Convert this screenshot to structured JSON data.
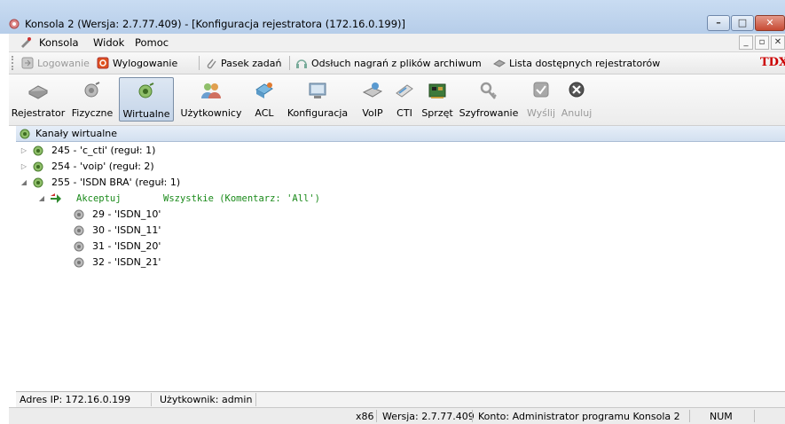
{
  "window": {
    "title": "Konsola 2 (Wersja:  2.7.77.409) - [Konfiguracja rejestratora (172.16.0.199)]",
    "minimize": "–",
    "maximize": "□",
    "close": "✕"
  },
  "menu": {
    "items": [
      "Konsola",
      "Widok",
      "Pomoc"
    ],
    "mdi_min": "_",
    "mdi_restore": "▫",
    "mdi_close": "✕"
  },
  "toolbar_top": {
    "login": "Logowanie",
    "logout": "Wylogowanie",
    "taskbar": "Pasek zadań",
    "listen": "Odsłuch nagrań z plików archiwum",
    "recorders": "Lista dostępnych rejestratorów",
    "brand": "TDX"
  },
  "toolbar_main": {
    "buttons": [
      {
        "label": "Rejestrator",
        "icon": "recorder-icon",
        "active": false,
        "enabled": true
      },
      {
        "label": "Fizyczne",
        "icon": "physical-channels-icon",
        "active": false,
        "enabled": true
      },
      {
        "label": "Wirtualne",
        "icon": "virtual-channels-icon",
        "active": true,
        "enabled": true
      },
      {
        "label": "Użytkownicy",
        "icon": "users-icon",
        "active": false,
        "enabled": true
      },
      {
        "label": "ACL",
        "icon": "acl-icon",
        "active": false,
        "enabled": true
      },
      {
        "label": "Konfiguracja",
        "icon": "configuration-icon",
        "active": false,
        "enabled": true
      },
      {
        "label": "VoIP",
        "icon": "voip-icon",
        "active": false,
        "enabled": true
      },
      {
        "label": "CTI",
        "icon": "cti-icon",
        "active": false,
        "enabled": true
      },
      {
        "label": "Sprzęt",
        "icon": "hardware-icon",
        "active": false,
        "enabled": true
      },
      {
        "label": "Szyfrowanie",
        "icon": "encryption-icon",
        "active": false,
        "enabled": true
      },
      {
        "label": "Wyślij",
        "icon": "send-icon",
        "active": false,
        "enabled": false
      },
      {
        "label": "Anuluj",
        "icon": "cancel-icon",
        "active": false,
        "enabled": false
      }
    ]
  },
  "panel": {
    "title": "Kanały wirtualne"
  },
  "tree": {
    "nodes": [
      {
        "label": "245 - 'c_cti' (reguł: 1)",
        "expander": "▷"
      },
      {
        "label": "254 - 'voip' (reguł: 2)",
        "expander": "▷"
      },
      {
        "label": "255 - 'ISDN BRA' (reguł: 1)",
        "expander": "◢"
      }
    ],
    "rule": {
      "action": "Akceptuj",
      "target": "Wszystkie (Komentarz: 'All')",
      "expander": "◢"
    },
    "channels": [
      "29 - 'ISDN_10'",
      "30 - 'ISDN_11'",
      "31 - 'ISDN_20'",
      "32 - 'ISDN_21'"
    ]
  },
  "status_line": {
    "ip": "Adres IP: 172.16.0.199",
    "user": "Użytkownik: admin"
  },
  "status_bar": {
    "arch": "x86",
    "version": "Wersja: 2.7.77.409",
    "account": "Konto: Administrator programu Konsola 2",
    "num": "NUM"
  },
  "colors": {
    "rule_text": "#1a8a1a",
    "active_button": "#c4d4e8",
    "close_button": "#c64a33"
  }
}
